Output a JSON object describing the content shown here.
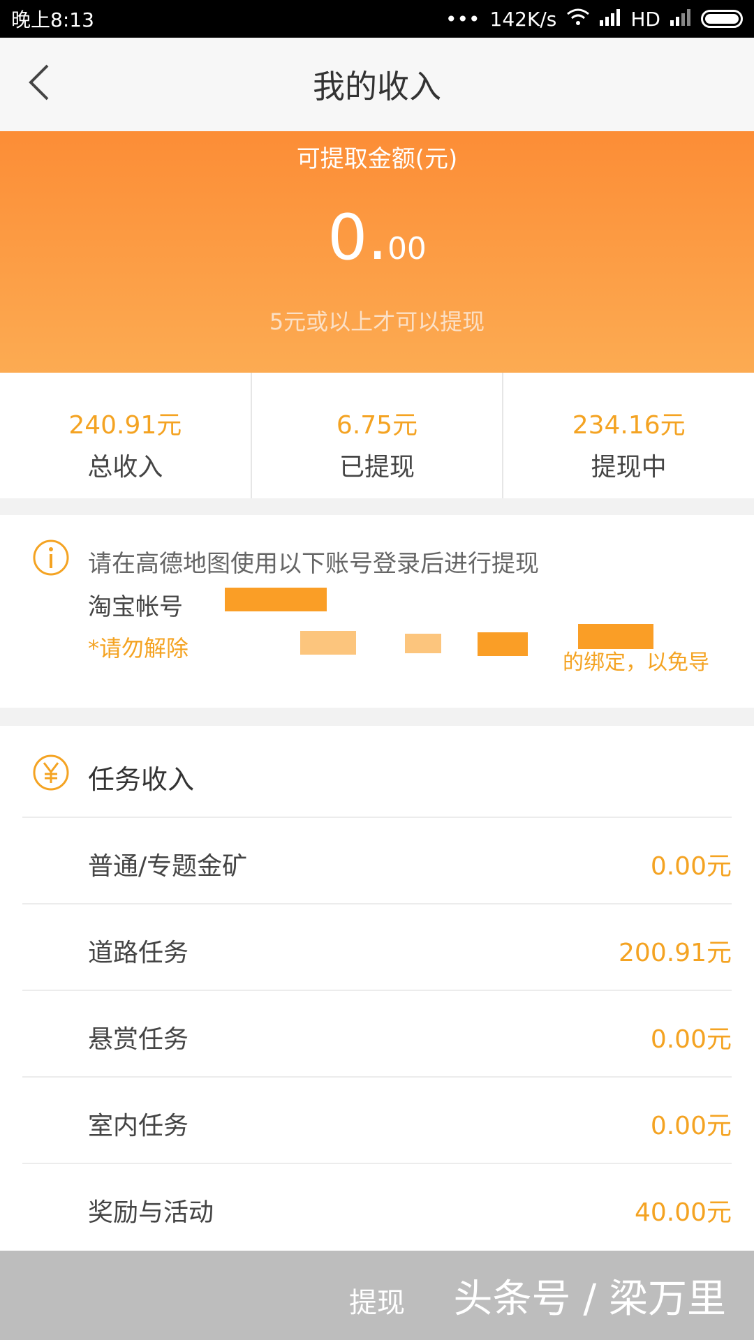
{
  "status": {
    "time": "晚上8:13",
    "dots": "•••",
    "speed": "142K/s",
    "hd": "HD"
  },
  "header": {
    "title": "我的收入",
    "back_icon": "chevron-left-icon"
  },
  "balance": {
    "label": "可提取金额(元)",
    "amount_int": "0.",
    "amount_dec": "00",
    "hint": "5元或以上才可以提现"
  },
  "stats": [
    {
      "value": "240.91元",
      "label": "总收入"
    },
    {
      "value": "6.75元",
      "label": "已提现"
    },
    {
      "value": "234.16元",
      "label": "提现中"
    }
  ],
  "notice": {
    "line1": "请在高德地图使用以下账号登录后进行提现",
    "line2": "淘宝帐号",
    "line3": "*请勿解除",
    "line3_end": "的绑定，以免导"
  },
  "task_income": {
    "title": "任务收入",
    "rows": [
      {
        "name": "普通/专题金矿",
        "value": "0.00元"
      },
      {
        "name": "道路任务",
        "value": "200.91元"
      },
      {
        "name": "悬赏任务",
        "value": "0.00元"
      },
      {
        "name": "室内任务",
        "value": "0.00元"
      },
      {
        "name": "奖励与活动",
        "value": "40.00元"
      }
    ]
  },
  "bottom": {
    "button": "提现",
    "watermark": "头条号 / 梁万里"
  },
  "colors": {
    "accent": "#f4a322",
    "banner_top": "#fc8d36",
    "banner_bottom": "#fcab52"
  }
}
